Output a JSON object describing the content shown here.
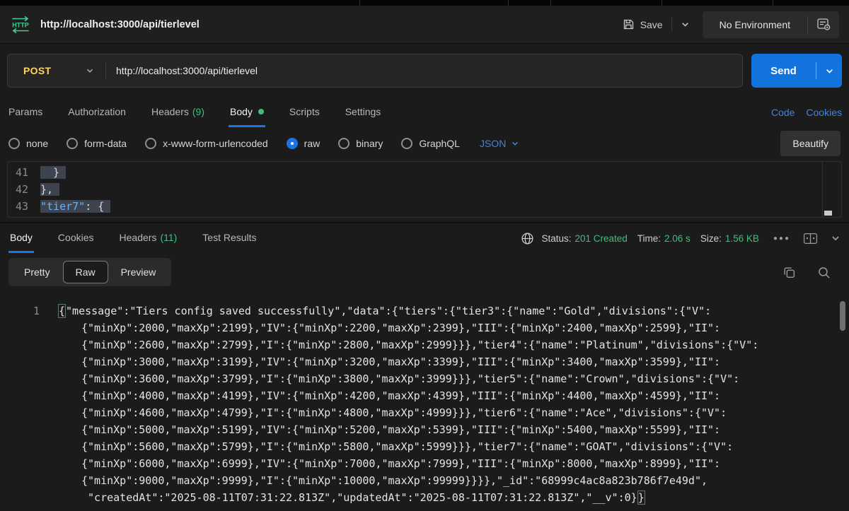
{
  "colors": {
    "accent_blue": "#1a73e8",
    "send_blue": "#1273de",
    "link_blue": "#3d85e4",
    "green": "#3fbf7f",
    "method_yellow": "#ffd75e",
    "http_icon_green": "#49cc90"
  },
  "topbar": {
    "request_title": "http://localhost:3000/api/tierlevel",
    "save_label": "Save",
    "environment_label": "No Environment"
  },
  "request": {
    "method": "POST",
    "url": "http://localhost:3000/api/tierlevel",
    "send_label": "Send",
    "tabs": [
      {
        "label": "Params"
      },
      {
        "label": "Authorization"
      },
      {
        "label": "Headers",
        "count": "(9)"
      },
      {
        "label": "Body"
      },
      {
        "label": "Scripts"
      },
      {
        "label": "Settings"
      }
    ],
    "code_link": "Code",
    "cookies_link": "Cookies",
    "body_modes": [
      "none",
      "form-data",
      "x-www-form-urlencoded",
      "raw",
      "binary",
      "GraphQL"
    ],
    "selected_mode": "raw",
    "language": "JSON",
    "beautify_label": "Beautify",
    "editor_lines": [
      {
        "num": "41",
        "selected": "  } "
      },
      {
        "num": "42",
        "selected": "}, "
      },
      {
        "num": "43",
        "key": "\"tier7\"",
        "rest": ": { "
      }
    ]
  },
  "response": {
    "tabs": [
      {
        "label": "Body"
      },
      {
        "label": "Cookies"
      },
      {
        "label": "Headers",
        "count": "(11)"
      },
      {
        "label": "Test Results"
      }
    ],
    "status_label": "Status:",
    "status_value": "201 Created",
    "time_label": "Time:",
    "time_value": "2.06 s",
    "size_label": "Size:",
    "size_value": "1.56 KB",
    "view_modes": [
      "Pretty",
      "Raw",
      "Preview"
    ],
    "selected_view": "Raw",
    "line_number": "1",
    "open_bracket": "{",
    "close_bracket": "}",
    "body_lines": [
      "\"message\":\"Tiers config saved successfully\",\"data\":{\"tiers\":{\"tier3\":{\"name\":\"Gold\",\"divisions\":{\"V\":",
      "{\"minXp\":2000,\"maxXp\":2199},\"IV\":{\"minXp\":2200,\"maxXp\":2399},\"III\":{\"minXp\":2400,\"maxXp\":2599},\"II\":",
      "{\"minXp\":2600,\"maxXp\":2799},\"I\":{\"minXp\":2800,\"maxXp\":2999}}},\"tier4\":{\"name\":\"Platinum\",\"divisions\":{\"V\":",
      "{\"minXp\":3000,\"maxXp\":3199},\"IV\":{\"minXp\":3200,\"maxXp\":3399},\"III\":{\"minXp\":3400,\"maxXp\":3599},\"II\":",
      "{\"minXp\":3600,\"maxXp\":3799},\"I\":{\"minXp\":3800,\"maxXp\":3999}}},\"tier5\":{\"name\":\"Crown\",\"divisions\":{\"V\":",
      "{\"minXp\":4000,\"maxXp\":4199},\"IV\":{\"minXp\":4200,\"maxXp\":4399},\"III\":{\"minXp\":4400,\"maxXp\":4599},\"II\":",
      "{\"minXp\":4600,\"maxXp\":4799},\"I\":{\"minXp\":4800,\"maxXp\":4999}}},\"tier6\":{\"name\":\"Ace\",\"divisions\":{\"V\":",
      "{\"minXp\":5000,\"maxXp\":5199},\"IV\":{\"minXp\":5200,\"maxXp\":5399},\"III\":{\"minXp\":5400,\"maxXp\":5599},\"II\":",
      "{\"minXp\":5600,\"maxXp\":5799},\"I\":{\"minXp\":5800,\"maxXp\":5999}}},\"tier7\":{\"name\":\"GOAT\",\"divisions\":{\"V\":",
      "{\"minXp\":6000,\"maxXp\":6999},\"IV\":{\"minXp\":7000,\"maxXp\":7999},\"III\":{\"minXp\":8000,\"maxXp\":8999},\"II\":",
      "{\"minXp\":9000,\"maxXp\":9999},\"I\":{\"minXp\":10000,\"maxXp\":99999}}}},\"_id\":\"68999c4ac8a823b786f7e49d\",",
      " \"createdAt\":\"2025-08-11T07:31:22.813Z\",\"updatedAt\":\"2025-08-11T07:31:22.813Z\",\"__v\":0}"
    ]
  }
}
